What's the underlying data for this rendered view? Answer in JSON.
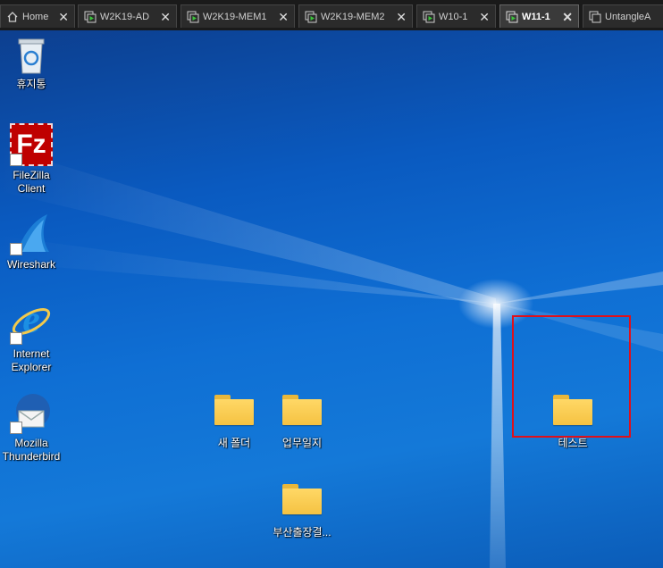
{
  "tabs": [
    {
      "label": "Home",
      "icon": "home-icon",
      "active": false
    },
    {
      "label": "W2K19-AD",
      "icon": "vm-icon",
      "active": false
    },
    {
      "label": "W2K19-MEM1",
      "icon": "vm-icon",
      "active": false
    },
    {
      "label": "W2K19-MEM2",
      "icon": "vm-icon",
      "active": false
    },
    {
      "label": "W10-1",
      "icon": "vm-icon",
      "active": false
    },
    {
      "label": "W11-1",
      "icon": "vm-icon",
      "active": true
    },
    {
      "label": "UntangleA",
      "icon": "vm-off-icon",
      "active": false
    }
  ],
  "tab_close_glyph": "✕",
  "desktop_icons": [
    {
      "label": "휴지통",
      "icon": "recycle-bin-icon"
    },
    {
      "label": "FileZilla\nClient",
      "icon": "filezilla-icon"
    },
    {
      "label": "Wireshark",
      "icon": "wireshark-icon"
    },
    {
      "label": "Internet\nExplorer",
      "icon": "internet-explorer-icon"
    },
    {
      "label": "Mozilla\nThunderbird",
      "icon": "thunderbird-icon"
    }
  ],
  "folders": [
    {
      "label": "새 폴더"
    },
    {
      "label": "업무일지"
    },
    {
      "label": "부산출장결..."
    },
    {
      "label": "테스트"
    }
  ],
  "filezilla_glyph": "Fz",
  "ie_glyph": "e",
  "colors": {
    "selection_border": "#e0101a",
    "folder": "#f5c242",
    "active_tab_text": "#ffffff"
  }
}
